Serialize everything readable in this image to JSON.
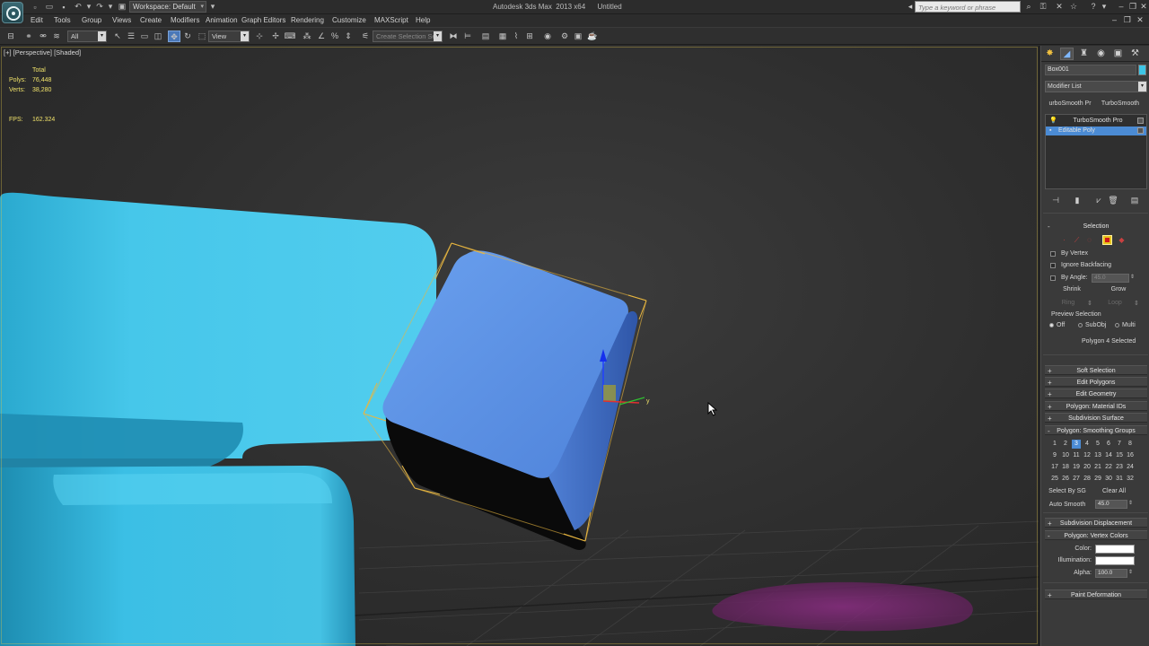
{
  "titlebar": {
    "workspace": "Workspace: Default",
    "app_title": "Autodesk 3ds Max  2013 x64      Untitled",
    "search_placeholder": "Type a keyword or phrase"
  },
  "menu": [
    "Edit",
    "Tools",
    "Group",
    "Views",
    "Create",
    "Modifiers",
    "Animation",
    "Graph Editors",
    "Rendering",
    "Customize",
    "MAXScript",
    "Help"
  ],
  "toolbar": {
    "selection_filter": "All",
    "reference_coord": "View",
    "named_selection_placeholder": "Create Selection Se"
  },
  "viewport": {
    "label": "[+] [Perspective] [Shaded]",
    "stats": {
      "header": "Total",
      "polys_label": "Polys:",
      "polys_value": "76,448",
      "verts_label": "Verts:",
      "verts_value": "38,280",
      "fps_label": "FPS:",
      "fps_value": "162.324"
    },
    "gizmo_label": "y",
    "colors": {
      "couch": "#49c6e8",
      "cube_face": "#5b8fe0",
      "selection_bracket": "#e8b640",
      "floor_blob": "#7a2a72"
    }
  },
  "command_panel": {
    "object_name": "Box001",
    "modifier_list": "Modifier List",
    "quick_buttons": [
      "urboSmooth Pr",
      "TurboSmooth"
    ],
    "stack": [
      {
        "name": "TurboSmooth Pro",
        "selected": false
      },
      {
        "name": "Editable Poly",
        "selected": true
      }
    ],
    "selection": {
      "title": "Selection",
      "by_vertex": "By Vertex",
      "ignore_backfacing": "Ignore Backfacing",
      "by_angle": "By Angle:",
      "by_angle_value": "45.0",
      "shrink": "Shrink",
      "grow": "Grow",
      "ring": "Ring",
      "loop": "Loop",
      "preview_selection": "Preview Selection",
      "preview_options": [
        "Off",
        "SubObj",
        "Multi"
      ],
      "status": "Polygon 4 Selected"
    },
    "rollouts_collapsed": [
      "Soft Selection",
      "Edit Polygons",
      "Edit Geometry",
      "Polygon: Material IDs",
      "Subdivision Surface"
    ],
    "smoothing_groups": {
      "title": "Polygon: Smoothing Groups",
      "numbers": [
        "1",
        "2",
        "3",
        "4",
        "5",
        "6",
        "7",
        "8",
        "9",
        "10",
        "11",
        "12",
        "13",
        "14",
        "15",
        "16",
        "17",
        "18",
        "19",
        "20",
        "21",
        "22",
        "23",
        "24",
        "25",
        "26",
        "27",
        "28",
        "29",
        "30",
        "31",
        "32"
      ],
      "active": "3",
      "select_by_sg": "Select By SG",
      "clear_all": "Clear All",
      "auto_smooth": "Auto Smooth",
      "auto_smooth_value": "45.0"
    },
    "subdivision_displacement": "Subdivision Displacement",
    "vertex_colors": {
      "title": "Polygon: Vertex Colors",
      "color_label": "Color:",
      "illumination_label": "Illumination:",
      "alpha_label": "Alpha:",
      "alpha_value": "100.0"
    },
    "paint_deformation": "Paint Deformation"
  }
}
